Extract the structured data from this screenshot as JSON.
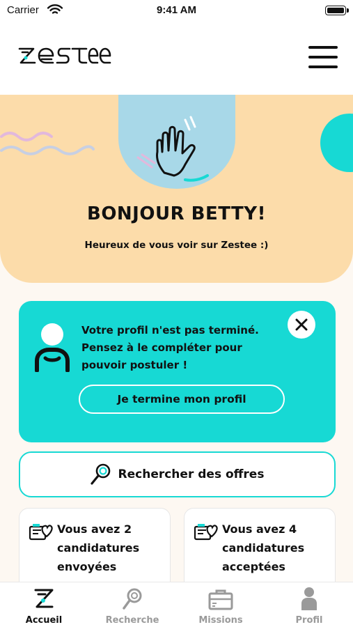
{
  "status_bar": {
    "carrier": "Carrier",
    "time": "9:41 AM"
  },
  "header": {
    "logo_text": "zestee",
    "menu_icon": "hamburger-menu-icon"
  },
  "hero": {
    "title": "BONJOUR BETTY!",
    "subtitle": "Heureux de vous voir sur Zestee :)",
    "illustration": "waving-hand-icon",
    "colors": {
      "background": "#fcdcaa",
      "circle": "#a8d8e8",
      "accent": "#17d9d4"
    }
  },
  "profile_card": {
    "message": "Votre profil n'est pas terminé. Pensez à le compléter pour pouvoir postuler !",
    "button_label": "Je termine mon profil",
    "close_icon": "close-icon",
    "color": "#17d9d4"
  },
  "search": {
    "label": "Rechercher des offres",
    "icon": "search-icon"
  },
  "stats": [
    {
      "text": "Vous avez 2 candidatures envoyées",
      "icon": "applications-icon"
    },
    {
      "text": "Vous avez 4 candidatures acceptées",
      "icon": "applications-icon"
    }
  ],
  "tabbar": {
    "tabs": [
      {
        "label": "Accueil",
        "icon": "home-z-icon",
        "active": true
      },
      {
        "label": "Recherche",
        "icon": "search-icon",
        "active": false
      },
      {
        "label": "Missions",
        "icon": "briefcase-icon",
        "active": false
      },
      {
        "label": "Profil",
        "icon": "profile-icon",
        "active": false
      }
    ]
  }
}
